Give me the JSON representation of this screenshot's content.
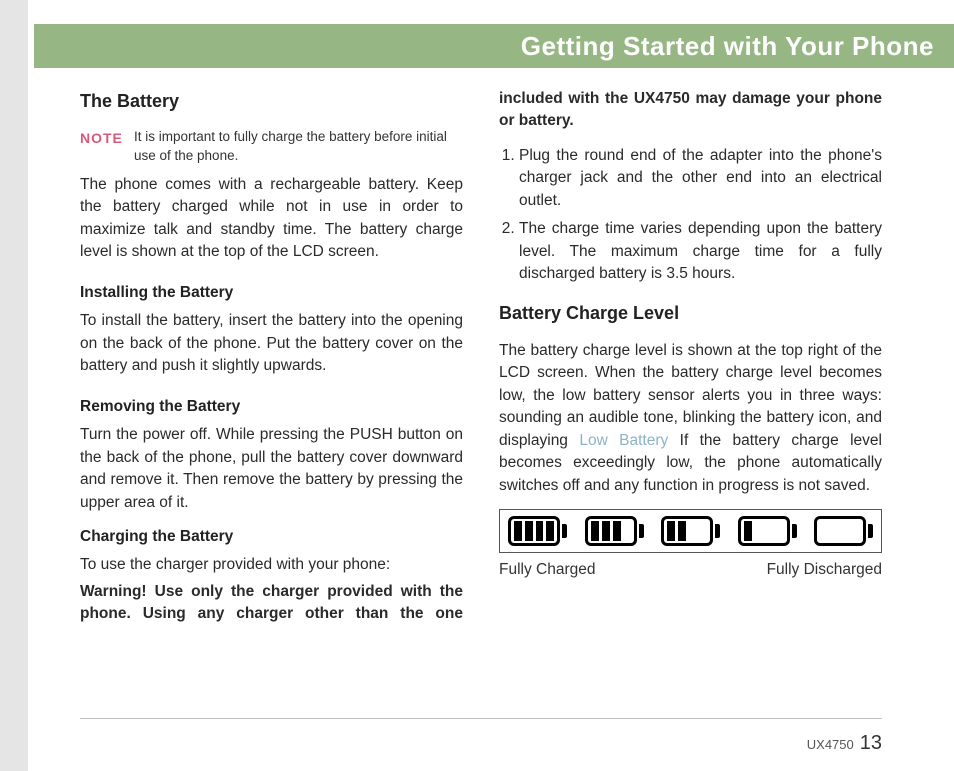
{
  "header": {
    "title": "Getting Started with Your Phone"
  },
  "footer": {
    "model": "UX4750",
    "page": "13"
  },
  "left": {
    "h_battery": "The Battery",
    "note_label": "NOTE",
    "note_text": "It is important to fully charge the battery before initial use of the phone.",
    "p1": "The phone comes with a rechargeable battery. Keep the battery charged while not in use in order to maximize talk and standby time. The battery charge level is shown at the top of the LCD screen.",
    "h_install": "Installing the Battery",
    "p_install": "To install the battery, insert the battery into the opening on the back of the phone. Put the battery cover on the battery and push it slightly upwards.",
    "h_remove": "Removing the Battery",
    "p_remove": "Turn the power off. While pressing the PUSH button on the back of the phone, pull the battery cover downward and remove it. Then remove the battery by pressing the upper area of it."
  },
  "right": {
    "h_charge": "Charging the Battery",
    "p_intro": "To use the charger provided with your phone:",
    "warning": "Warning! Use only the charger provided with the phone. Using any charger other than the one included with the UX4750 may damage your phone or battery.",
    "step1": "Plug the round end of the adapter into the phone's charger jack and the other end into an electrical outlet.",
    "step2": "The charge time varies depending upon the battery level. The maximum charge time for a fully discharged battery is 3.5 hours.",
    "h_level": "Battery Charge Level",
    "p_level_a": "The battery charge level is shown at the top right of the LCD screen. When the battery charge level becomes low, the low battery sensor alerts you in three ways: sounding an audible tone, blinking the battery icon, and displaying ",
    "low_battery": "Low Battery",
    "p_level_b": " If the battery charge level becomes exceedingly low, the phone automatically switches off and any function in progress is not saved.",
    "label_full": "Fully Charged",
    "label_empty": "Fully Discharged"
  }
}
